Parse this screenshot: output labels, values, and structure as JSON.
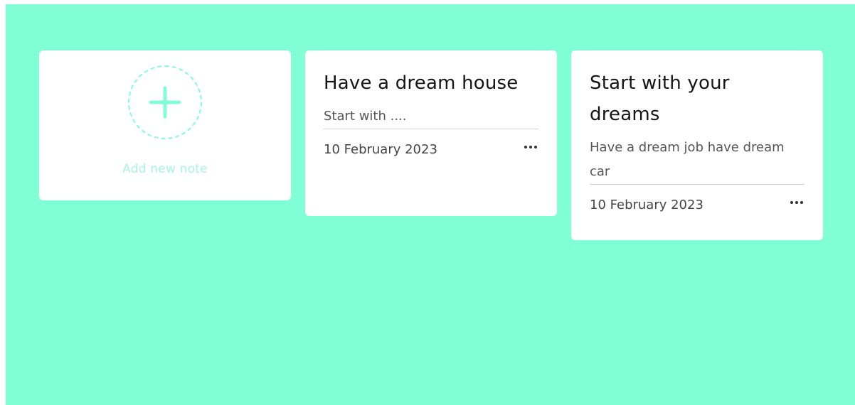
{
  "colors": {
    "page_background": "#80ffd5",
    "card_background": "#ffffff",
    "accent": "#80ffd5",
    "add_label": "#a4f7da"
  },
  "add_card": {
    "label": "Add new note",
    "icon": "plus-icon"
  },
  "notes": [
    {
      "title": "Have a dream house",
      "body": "Start with ....",
      "date": "10 February 2023",
      "menu_icon": "more-horizontal-icon"
    },
    {
      "title": "Start with your dreams",
      "body": "Have a dream job have dream car",
      "date": "10 February 2023",
      "menu_icon": "more-horizontal-icon"
    }
  ]
}
